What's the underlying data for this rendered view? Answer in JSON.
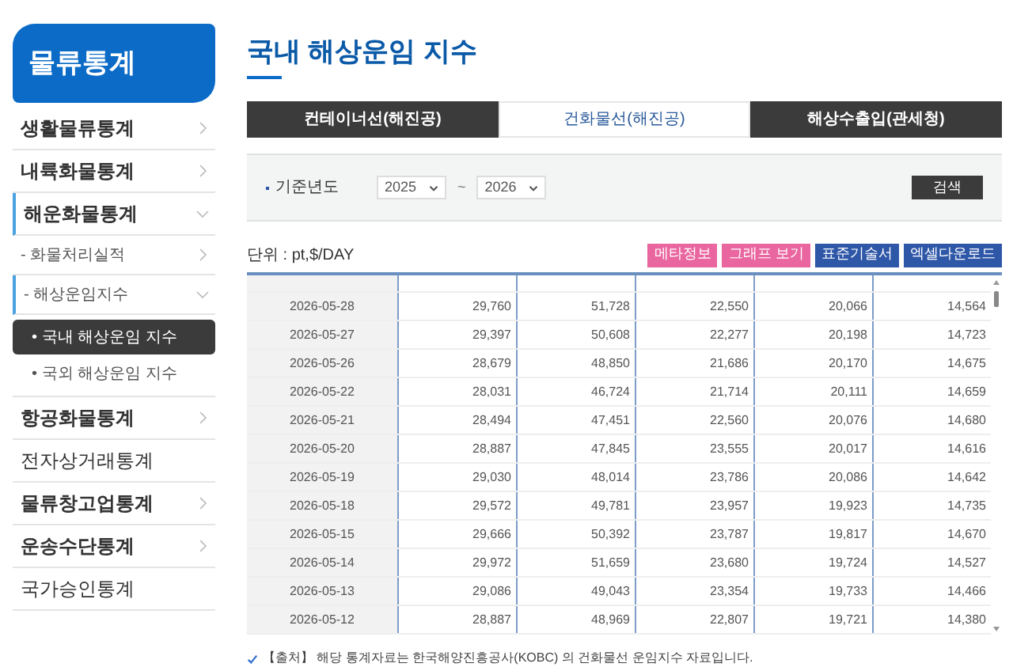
{
  "sidebar": {
    "title": "물류통계",
    "items": [
      {
        "label": "생활물류통계",
        "kind": "group",
        "expanded": false
      },
      {
        "label": "내륙화물통계",
        "kind": "group",
        "expanded": false
      },
      {
        "label": "해운화물통계",
        "kind": "group",
        "expanded": true,
        "children": [
          {
            "label": "- 화물처리실적",
            "expanded": false
          },
          {
            "label": "- 해상운임지수",
            "expanded": true,
            "children": [
              {
                "label": "• 국내 해상운임 지수",
                "selected": true
              },
              {
                "label": "• 국외 해상운임 지수",
                "selected": false
              }
            ]
          }
        ]
      },
      {
        "label": "항공화물통계",
        "kind": "group",
        "expanded": false
      },
      {
        "label": "전자상거래통계",
        "kind": "link"
      },
      {
        "label": "물류창고업통계",
        "kind": "group",
        "expanded": false
      },
      {
        "label": "운송수단통계",
        "kind": "group",
        "expanded": false
      },
      {
        "label": "국가승인통계",
        "kind": "link"
      }
    ]
  },
  "page_title": "국내 해상운임 지수",
  "tabs": [
    {
      "label": "컨테이너선(해진공)",
      "selected": false
    },
    {
      "label": "건화물선(해진공)",
      "selected": true
    },
    {
      "label": "해상수출입(관세청)",
      "selected": false
    }
  ],
  "filter": {
    "label": "기준년도",
    "from": "2025",
    "separator": "~",
    "to": "2026",
    "search_button": "검색"
  },
  "unit": "단위 : pt,$/DAY",
  "actions": [
    {
      "label": "메타정보",
      "kind": "pink"
    },
    {
      "label": "그래프 보기",
      "kind": "pink"
    },
    {
      "label": "표준기술서",
      "kind": "blue"
    },
    {
      "label": "엑셀다운로드",
      "kind": "blue"
    }
  ],
  "table": {
    "rows": [
      {
        "date": "2026-05-28",
        "values": [
          "29,760",
          "51,728",
          "22,550",
          "20,066",
          "14,564"
        ]
      },
      {
        "date": "2026-05-27",
        "values": [
          "29,397",
          "50,608",
          "22,277",
          "20,198",
          "14,723"
        ]
      },
      {
        "date": "2026-05-26",
        "values": [
          "28,679",
          "48,850",
          "21,686",
          "20,170",
          "14,675"
        ]
      },
      {
        "date": "2026-05-22",
        "values": [
          "28,031",
          "46,724",
          "21,714",
          "20,111",
          "14,659"
        ]
      },
      {
        "date": "2026-05-21",
        "values": [
          "28,494",
          "47,451",
          "22,560",
          "20,076",
          "14,680"
        ]
      },
      {
        "date": "2026-05-20",
        "values": [
          "28,887",
          "47,845",
          "23,555",
          "20,017",
          "14,616"
        ]
      },
      {
        "date": "2026-05-19",
        "values": [
          "29,030",
          "48,014",
          "23,786",
          "20,086",
          "14,642"
        ]
      },
      {
        "date": "2026-05-18",
        "values": [
          "29,572",
          "49,781",
          "23,957",
          "19,923",
          "14,735"
        ]
      },
      {
        "date": "2026-05-15",
        "values": [
          "29,666",
          "50,392",
          "23,787",
          "19,817",
          "14,670"
        ]
      },
      {
        "date": "2026-05-14",
        "values": [
          "29,972",
          "51,659",
          "23,680",
          "19,724",
          "14,527"
        ]
      },
      {
        "date": "2026-05-13",
        "values": [
          "29,086",
          "49,043",
          "23,354",
          "19,733",
          "14,466"
        ]
      },
      {
        "date": "2026-05-12",
        "values": [
          "28,887",
          "48,969",
          "22,807",
          "19,721",
          "14,380"
        ]
      }
    ]
  },
  "source_note": "【출처】 해당 통계자료는 한국해양진흥공사(KOBC) 의 건화물선 운임지수 자료입니다."
}
